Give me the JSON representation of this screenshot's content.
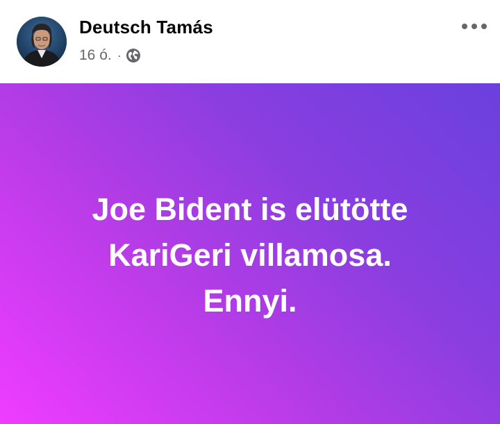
{
  "author": {
    "name": "Deutsch Tamás"
  },
  "meta": {
    "time": "16 ó.",
    "separator": "·",
    "audience_icon": "globe-icon"
  },
  "header": {
    "more_icon": "more-options-icon"
  },
  "post": {
    "lines": [
      "Joe Bident is elütötte",
      "KariGeri villamosa.",
      "Ennyi."
    ]
  }
}
